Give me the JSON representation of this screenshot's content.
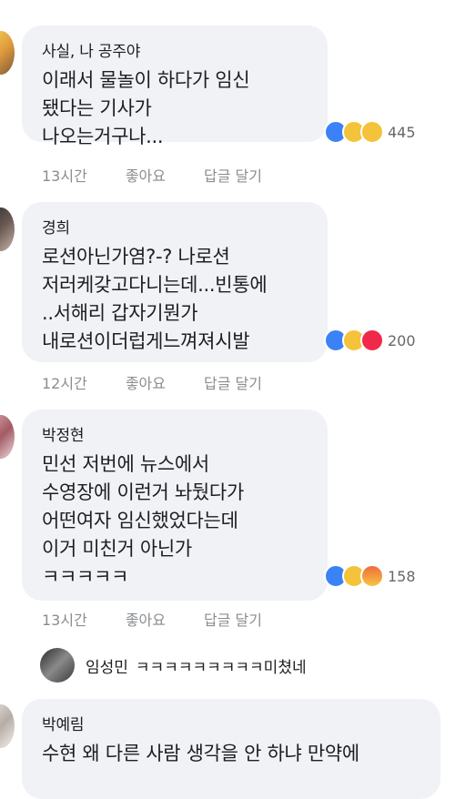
{
  "comments": [
    {
      "author": "사실, 나 공주야",
      "lines": [
        "이래서 물놀이 하다가 임신",
        "됐다는 기사가",
        "나오는거구나..."
      ],
      "reaction_icons": [
        "like-icon",
        "haha-icon",
        "sad-icon"
      ],
      "reaction_count": "445",
      "time": "13시간",
      "like": "좋아요",
      "reply": "답글 달기"
    },
    {
      "author": "경희",
      "lines": [
        "로션아닌가염?-? 나로션",
        "저러케갖고다니는데...빈통에",
        "..서해리 갑자기뭔가",
        "내로션이더럽게느껴져시발"
      ],
      "reaction_icons": [
        "like-icon",
        "haha-icon",
        "love-icon"
      ],
      "reaction_count": "200",
      "time": "12시간",
      "like": "좋아요",
      "reply": "답글 달기"
    },
    {
      "author": "박정현",
      "lines": [
        "민선 저번에 뉴스에서",
        "수영장에 이런거 놔뒀다가",
        "어떤여자 임신했었다는데",
        "이거 미친거 아닌가",
        "ㅋㅋㅋㅋㅋ"
      ],
      "reaction_icons": [
        "like-icon",
        "haha-icon",
        "angry-icon"
      ],
      "reaction_count": "158",
      "time": "13시간",
      "like": "좋아요",
      "reply": "답글 달기"
    },
    {
      "author": "박예림",
      "lines": [
        "수현 왜 다른 사람 생각을 안 하냐 만약에"
      ]
    }
  ],
  "reply": {
    "name": "임성민",
    "text": "ㅋㅋㅋㅋㅋㅋㅋㅋㅋ미쳤네"
  }
}
